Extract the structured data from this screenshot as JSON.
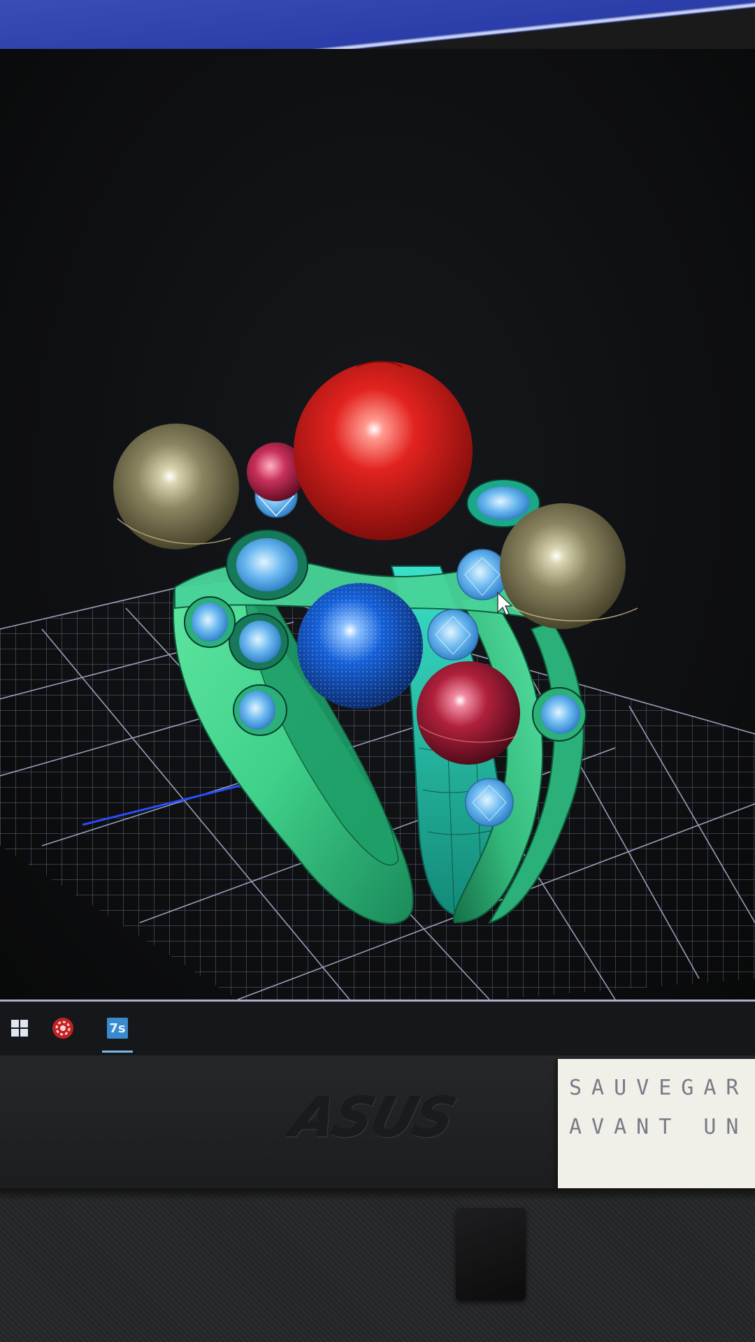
{
  "window": {
    "accent_color": "#3a4cb8"
  },
  "viewport": {
    "background": "#0d0e10",
    "grid_color": "#8a94b8",
    "axis_color": "#2a4cff",
    "model": {
      "band_color": "#3fd08a",
      "stones": [
        {
          "name": "large-red-sphere",
          "color": "#e2231f"
        },
        {
          "name": "blue-sphere",
          "color": "#1560d8"
        },
        {
          "name": "burgundy-sphere",
          "color": "#b0203c"
        },
        {
          "name": "pink-sphere",
          "color": "#c8305a"
        },
        {
          "name": "olive-pearl-left",
          "color": "#8a8460"
        },
        {
          "name": "olive-pearl-right",
          "color": "#7a7450"
        },
        {
          "name": "diamond",
          "color": "#6ab8f0"
        }
      ]
    }
  },
  "taskbar": {
    "items": [
      {
        "name": "windows-start-icon",
        "label": ""
      },
      {
        "name": "app-red-gear-icon",
        "label": ""
      },
      {
        "name": "app-7s-icon",
        "label": "7s"
      }
    ]
  },
  "monitor": {
    "brand": "ASUS",
    "sticky_note": {
      "line1": "SAUVEGAR",
      "line2": "AVANT UN"
    }
  }
}
